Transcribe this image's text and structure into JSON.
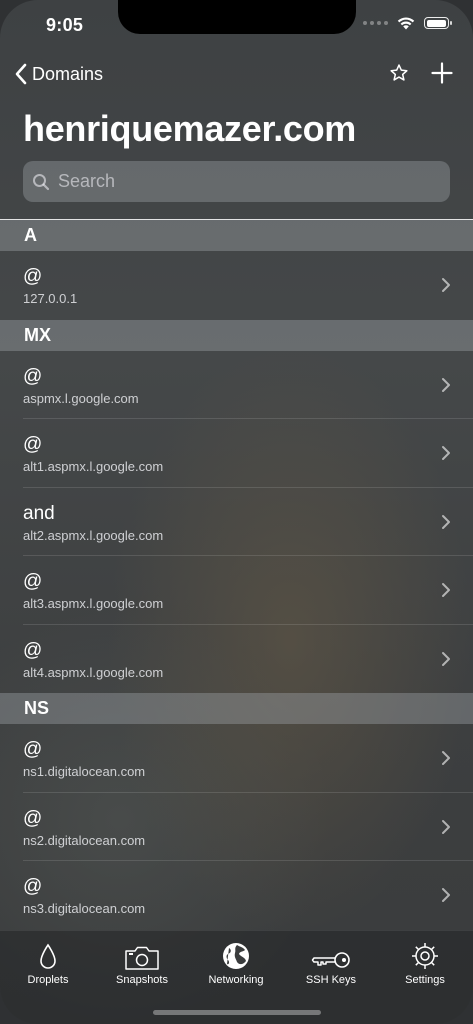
{
  "status": {
    "time": "9:05"
  },
  "nav": {
    "back_label": "Domains"
  },
  "title": "henriquemazer.com",
  "search": {
    "placeholder": "Search"
  },
  "sections": [
    {
      "header": "A",
      "rows": [
        {
          "name": "@",
          "value": "127.0.0.1"
        }
      ]
    },
    {
      "header": "MX",
      "rows": [
        {
          "name": "@",
          "value": "aspmx.l.google.com"
        },
        {
          "name": "@",
          "value": "alt1.aspmx.l.google.com"
        },
        {
          "name": "and",
          "value": "alt2.aspmx.l.google.com"
        },
        {
          "name": "@",
          "value": "alt3.aspmx.l.google.com"
        },
        {
          "name": "@",
          "value": "alt4.aspmx.l.google.com"
        }
      ]
    },
    {
      "header": "NS",
      "rows": [
        {
          "name": "@",
          "value": "ns1.digitalocean.com"
        },
        {
          "name": "@",
          "value": "ns2.digitalocean.com"
        },
        {
          "name": "@",
          "value": "ns3.digitalocean.com"
        }
      ]
    }
  ],
  "tabbar": {
    "droplets": "Droplets",
    "snapshots": "Snapshots",
    "networking": "Networking",
    "ssh_keys": "SSH Keys",
    "settings": "Settings"
  }
}
